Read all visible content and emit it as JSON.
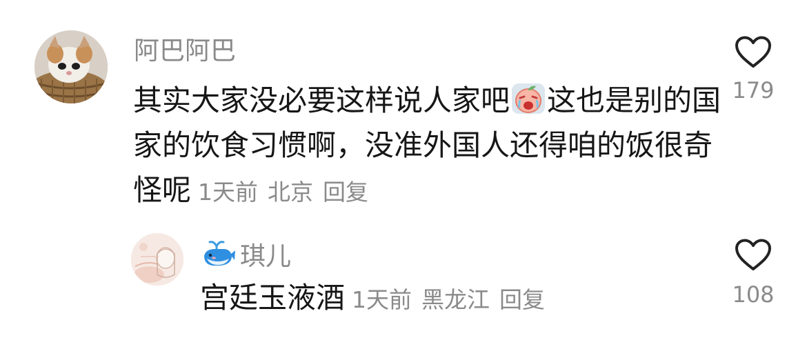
{
  "comments": [
    {
      "author": "阿巴阿巴",
      "text_part1": "其实大家没必要这样说人家吧",
      "emoji": "crying-peach-emoji",
      "text_part2": "这也是别的国家的饮食习惯啊，没准外国人还得咱的饭很奇怪呢",
      "time": "1天前",
      "location": "北京",
      "reply_label": "回复",
      "likes": "179",
      "avatar": "kitten-in-basket"
    },
    {
      "badge_icon": "whale-icon",
      "author": "琪儿",
      "text": "宫廷玉液酒",
      "time": "1天前",
      "location": "黑龙江",
      "reply_label": "回复",
      "likes": "108",
      "avatar": "illustrated-girl"
    }
  ],
  "colors": {
    "text_primary": "#161616",
    "text_secondary": "#8a8a8a",
    "icon": "#222222",
    "background": "#ffffff"
  }
}
